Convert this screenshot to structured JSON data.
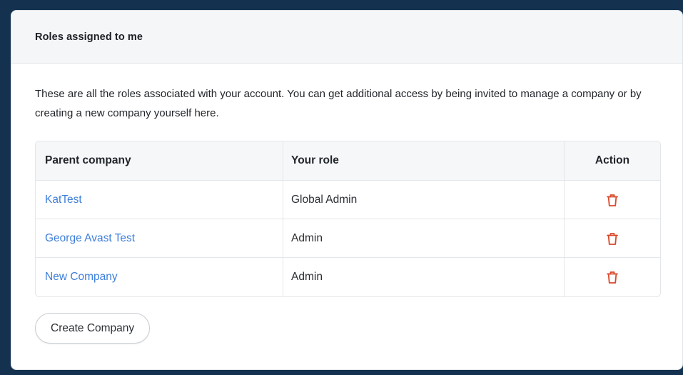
{
  "card": {
    "title": "Roles assigned to me",
    "intro": "These are all the roles associated with your account. You can get additional access by being invited to manage a company or by creating a new company yourself here."
  },
  "table": {
    "headers": {
      "parent_company": "Parent company",
      "your_role": "Your role",
      "action": "Action"
    },
    "rows": [
      {
        "company": "KatTest",
        "role": "Global Admin",
        "action_icon": "trash-icon"
      },
      {
        "company": "George Avast Test",
        "role": "Admin",
        "action_icon": "trash-icon"
      },
      {
        "company": "New Company",
        "role": "Admin",
        "action_icon": "trash-icon"
      }
    ]
  },
  "actions": {
    "create_label": "Create Company"
  },
  "colors": {
    "background": "#14324f",
    "link": "#3f7fd9",
    "delete_icon": "#d9482b"
  }
}
